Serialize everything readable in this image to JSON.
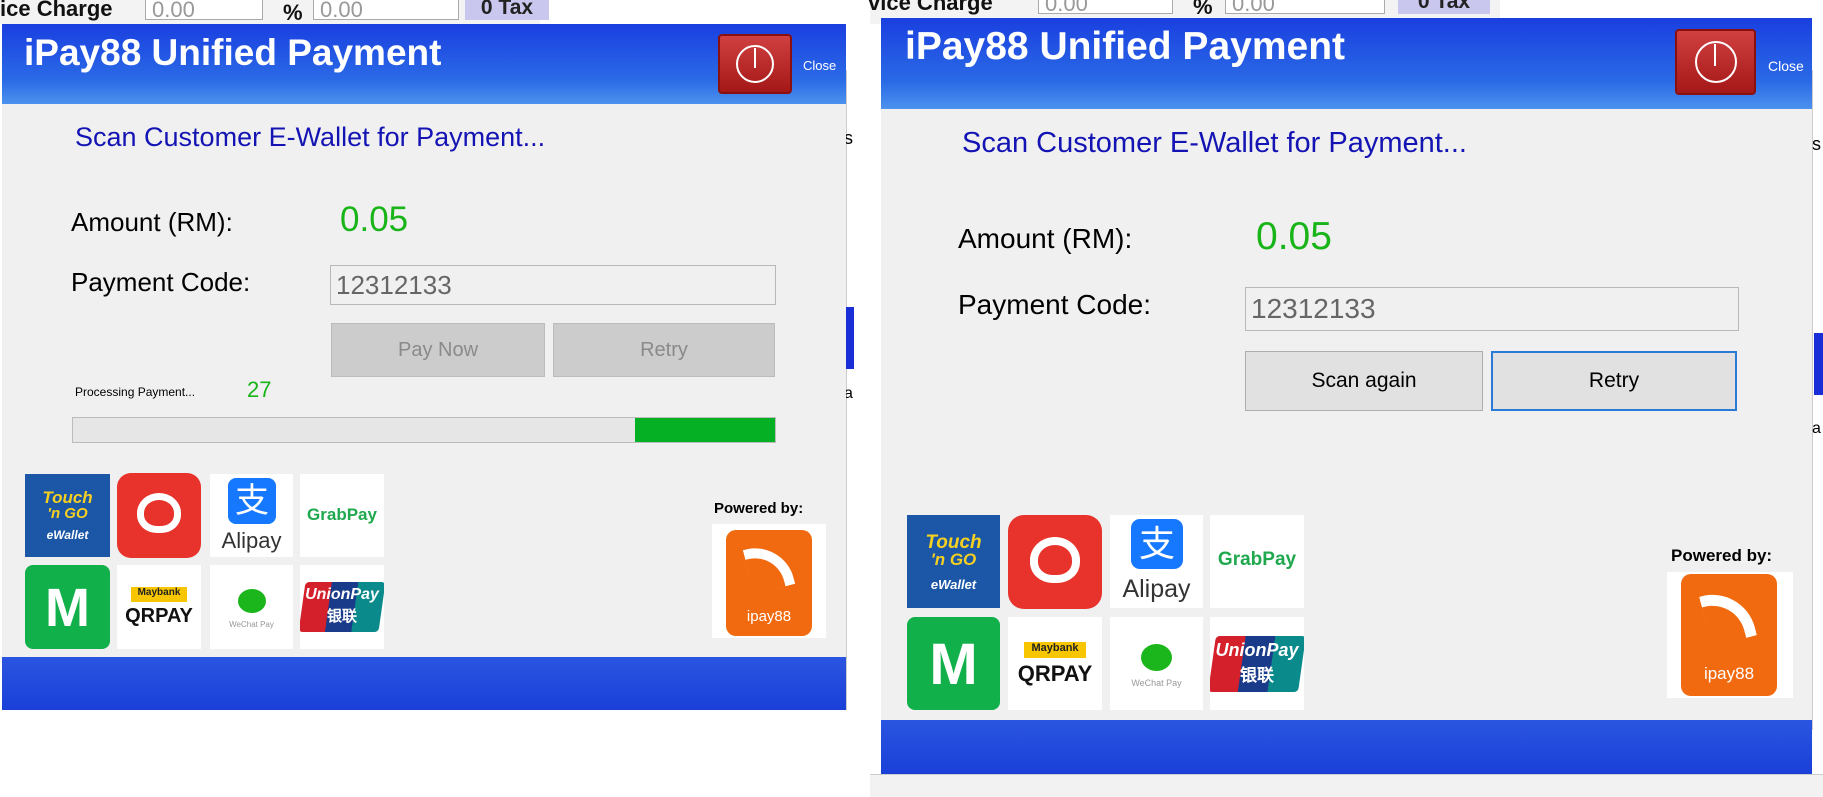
{
  "background": {
    "left": {
      "label": "ice Charge",
      "value": "0.00",
      "percent": "%",
      "percent_value": "0.00",
      "tax_button": "0 Tax"
    },
    "right": {
      "label": "vice Charge",
      "value": "0.00",
      "percent": "%",
      "percent_value": "0.00",
      "tax_button": "0 Tax"
    },
    "edge_letters": {
      "s1": "s",
      "a1": "a",
      "s2": "s",
      "a2": "a"
    }
  },
  "panels": [
    {
      "title": "iPay88 Unified Payment",
      "close_label": "Close",
      "message": "Scan Customer E-Wallet for Payment...",
      "amount_label": "Amount (RM):",
      "amount_value": "0.05",
      "code_label": "Payment Code:",
      "code_value": "12312133",
      "button_1": "Pay Now",
      "button_2": "Retry",
      "processing_label": "Processing Payment...",
      "countdown": "27",
      "progress_fraction": 0.2,
      "powered_by": "Powered by:",
      "ipay_logo_text": "ipay88"
    },
    {
      "title": "iPay88 Unified Payment",
      "close_label": "Close",
      "message": "Scan Customer E-Wallet for Payment...",
      "amount_label": "Amount (RM):",
      "amount_value": "0.05",
      "code_label": "Payment Code:",
      "code_value": "12312133",
      "button_1": "Scan again",
      "button_2": "Retry",
      "powered_by": "Powered by:",
      "ipay_logo_text": "ipay88"
    }
  ],
  "wallets": {
    "touchngo": {
      "line1": "Touch",
      "line2": "'n GO",
      "line3": "eWallet"
    },
    "boost": {
      "icon": "heart-icon"
    },
    "alipay": {
      "glyph": "支",
      "name": "Alipay"
    },
    "grabpay": {
      "name": "GrabPay"
    },
    "mcash": {
      "letter": "M"
    },
    "qrpay": {
      "bank": "Maybank",
      "name": "QRPAY"
    },
    "wechat": {
      "name": "WeChat Pay"
    },
    "unionpay": {
      "line1": "UnionPay",
      "line2": "银联"
    }
  },
  "colors": {
    "header_blue": "#2a6ae6",
    "amount_green": "#18b418",
    "message_blue": "#1414b4",
    "progress_green": "#06b025",
    "close_red": "#c02828"
  }
}
